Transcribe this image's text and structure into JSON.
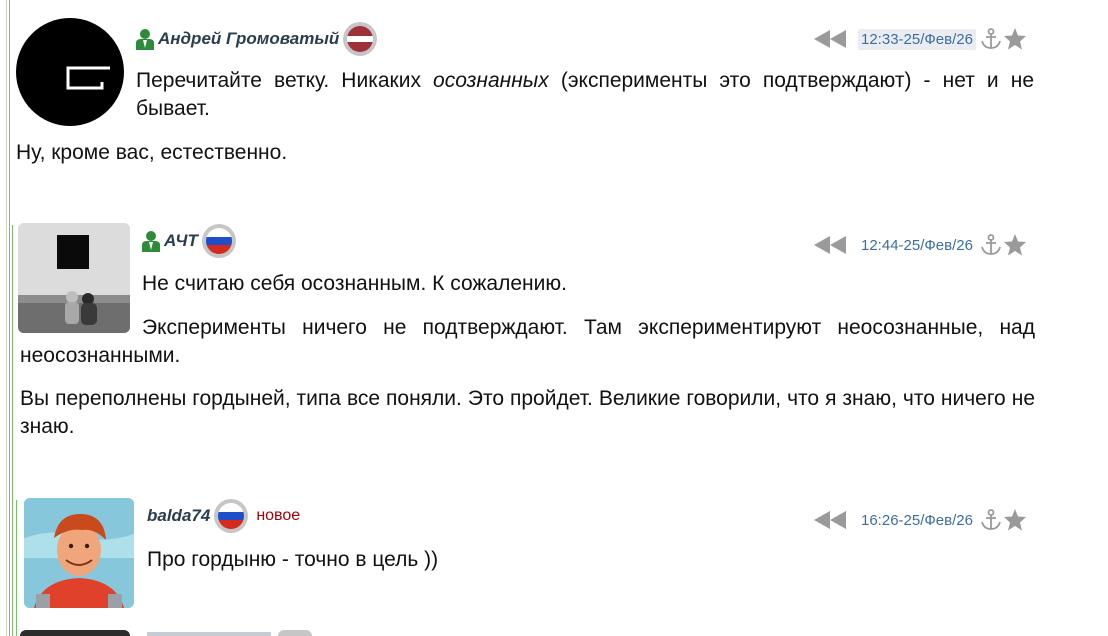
{
  "comments": [
    {
      "author": "Андрей Громоватый",
      "flag": "latvia",
      "time": "12:33-25/Фев/26",
      "time_highlighted": true,
      "lines": {
        "p1_a": "Перечитайте ветку. Никаких ",
        "p1_em": "осознанных",
        "p1_b": " (эксперименты это подтверждают) - нет и не бывает.",
        "p2": "Ну, кроме вас, естественно."
      }
    },
    {
      "author": "АЧТ",
      "flag": "russia",
      "time": "12:44-25/Фев/26",
      "lines": {
        "p1": "Не считаю себя осознанным. К сожалению.",
        "p2": "Эксперименты ничего не подтверждают. Там экспериментируют неосознанные, над неосознанными.",
        "p3": "Вы переполнены гордыней, типа все поняли. Это пройдет. Великие говорили, что я знаю, что ничего не знаю."
      }
    },
    {
      "author": "balda74",
      "flag": "russia",
      "badge": "новое",
      "time": "16:26-25/Фев/26",
      "lines": {
        "p1": "Про гордыню - точно в цель ))"
      }
    }
  ],
  "icons": {
    "user": "user-icon",
    "reply_back": "double-left-arrow-icon",
    "anchor": "anchor-icon",
    "favorite": "star-icon"
  },
  "colors": {
    "author": "#2a3d4f",
    "time": "#3d6ea0",
    "new_badge": "#aa0000",
    "rail": "#7bbf6a",
    "icon_gray": "#9a9a9a",
    "user_icon_green": "#2e8b3a"
  }
}
